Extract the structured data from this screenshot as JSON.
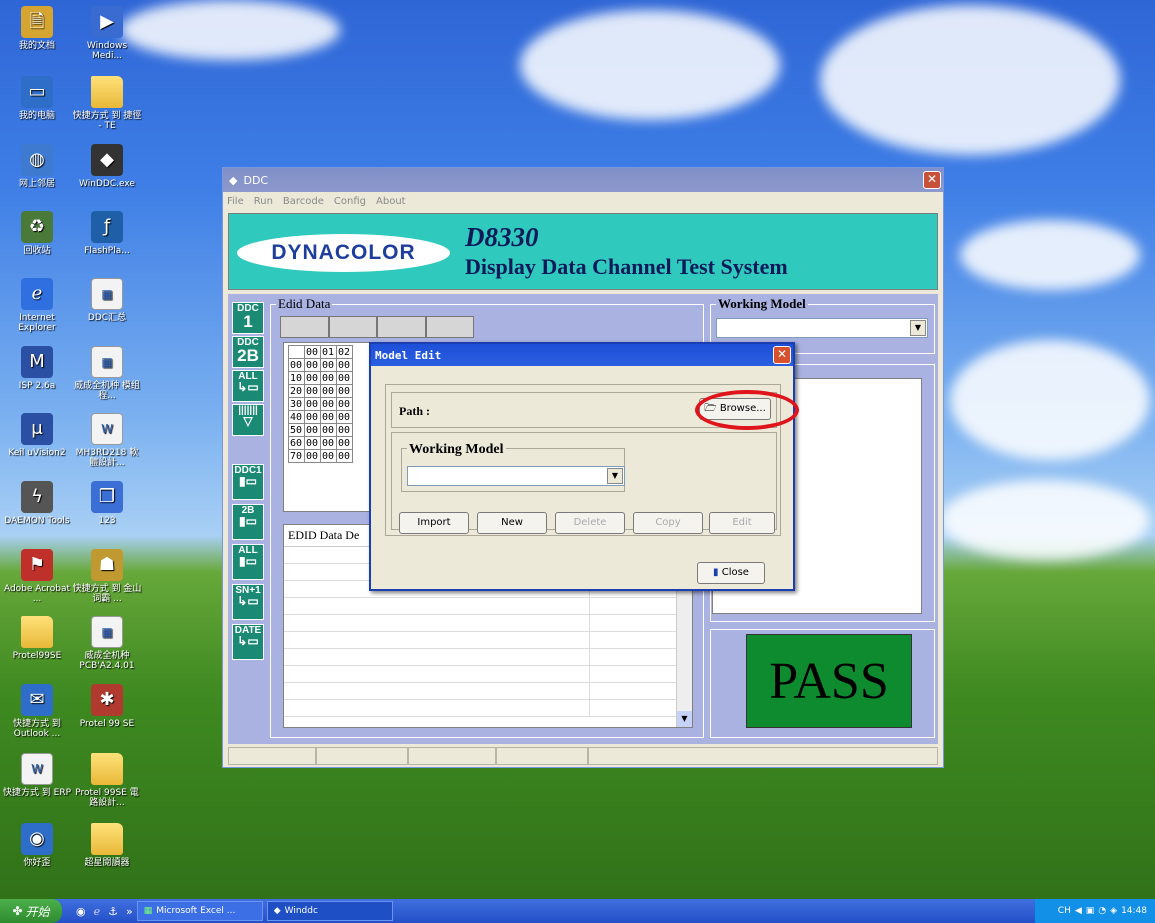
{
  "desktop": {
    "icons": [
      {
        "label": "我的文档",
        "icon": "my-documents-icon"
      },
      {
        "label": "Windows Medi...",
        "icon": "windows-media-icon"
      },
      {
        "label": "我的电脑",
        "icon": "my-computer-icon"
      },
      {
        "label": "快捷方式 到 捷徑 - TE",
        "icon": "folder-icon"
      },
      {
        "label": "网上邻居",
        "icon": "network-icon"
      },
      {
        "label": "WinDDC.exe",
        "icon": "winddc-icon"
      },
      {
        "label": "回收站",
        "icon": "recycle-bin-icon"
      },
      {
        "label": "FlashPla...",
        "icon": "flash-icon"
      },
      {
        "label": "Internet Explorer",
        "icon": "ie-icon"
      },
      {
        "label": "DDC汇总",
        "icon": "excel-doc-icon"
      },
      {
        "label": "ISP 2.6a",
        "icon": "isp-icon"
      },
      {
        "label": "威成全机种 模组程...",
        "icon": "excel-doc-icon"
      },
      {
        "label": "Keil uVision2",
        "icon": "keil-icon"
      },
      {
        "label": "MH3RD218 軟體設計...",
        "icon": "word-doc-icon"
      },
      {
        "label": "DAEMON Tools",
        "icon": "daemon-tools-icon"
      },
      {
        "label": "123",
        "icon": "book-icon"
      },
      {
        "label": "Adobe Acrobat ...",
        "icon": "acrobat-icon"
      },
      {
        "label": "快捷方式 到 金山词霸 ...",
        "icon": "dictionary-icon"
      },
      {
        "label": "Protel99SE",
        "icon": "folder-icon"
      },
      {
        "label": "威成全机种 PCB'A2.4.01",
        "icon": "excel-doc-icon"
      },
      {
        "label": "快捷方式 到 Outlook ...",
        "icon": "outlook-icon"
      },
      {
        "label": "Protel 99 SE",
        "icon": "protel-icon"
      },
      {
        "label": "快捷方式 到 ERP",
        "icon": "word-doc-icon"
      },
      {
        "label": "Protel 99SE 電路設計...",
        "icon": "folder-icon"
      },
      {
        "label": "你好歪",
        "icon": "media-icon"
      },
      {
        "label": "超星閱讀器",
        "icon": "folder-icon"
      }
    ]
  },
  "main_window": {
    "title": "DDC",
    "menu": [
      "File",
      "Run",
      "Barcode",
      "Config",
      "About"
    ],
    "banner": {
      "logo": "DYNACOLOR",
      "model": "D8330",
      "subtitle": "Display Data Channel Test System"
    },
    "side_buttons": [
      {
        "top": "DDC",
        "big": "1"
      },
      {
        "top": "DDC",
        "big": "2B"
      },
      {
        "top": "ALL",
        "big": "↳▭"
      },
      {
        "top": "|||||||",
        "big": "▽"
      },
      {
        "top": "DDC1",
        "big": "▮▭"
      },
      {
        "top": "2B",
        "big": "▮▭"
      },
      {
        "top": "ALL",
        "big": "▮▭"
      },
      {
        "top": "SN+1",
        "big": "↳▭"
      },
      {
        "top": "DATE",
        "big": "↳▭"
      }
    ],
    "edid_group_label": "Edid Data",
    "hex_header": [
      "00",
      "01",
      "02"
    ],
    "hex_rows": [
      {
        "addr": "00",
        "vals": [
          "00",
          "00",
          "00"
        ]
      },
      {
        "addr": "10",
        "vals": [
          "00",
          "00",
          "00"
        ]
      },
      {
        "addr": "20",
        "vals": [
          "00",
          "00",
          "00"
        ]
      },
      {
        "addr": "30",
        "vals": [
          "00",
          "00",
          "00"
        ]
      },
      {
        "addr": "40",
        "vals": [
          "00",
          "00",
          "00"
        ]
      },
      {
        "addr": "50",
        "vals": [
          "00",
          "00",
          "00"
        ]
      },
      {
        "addr": "60",
        "vals": [
          "00",
          "00",
          "00"
        ]
      },
      {
        "addr": "70",
        "vals": [
          "00",
          "00",
          "00"
        ]
      }
    ],
    "edid_desc_label": "EDID Data De",
    "working_model_label": "Working Model",
    "working_model_value": "",
    "result": "PASS"
  },
  "dialog": {
    "title": "Model Edit",
    "path_label": "Path :",
    "browse_label": "Browse...",
    "working_model_label": "Working Model",
    "working_model_value": "",
    "buttons": {
      "import": "Import",
      "new": "New",
      "delete": "Delete",
      "copy": "Copy",
      "edit": "Edit"
    },
    "close_label": "Close"
  },
  "taskbar": {
    "start": "开始",
    "tasks": [
      "Microsoft Excel ...",
      "Winddc"
    ],
    "lang": "CH",
    "clock": "14:48"
  },
  "colors": {
    "banner": "#2fc9bd",
    "workarea": "#a9b2e0",
    "side_button": "#1b8a75",
    "pass": "#0d8b2e",
    "highlight_ring": "#e0141b"
  }
}
